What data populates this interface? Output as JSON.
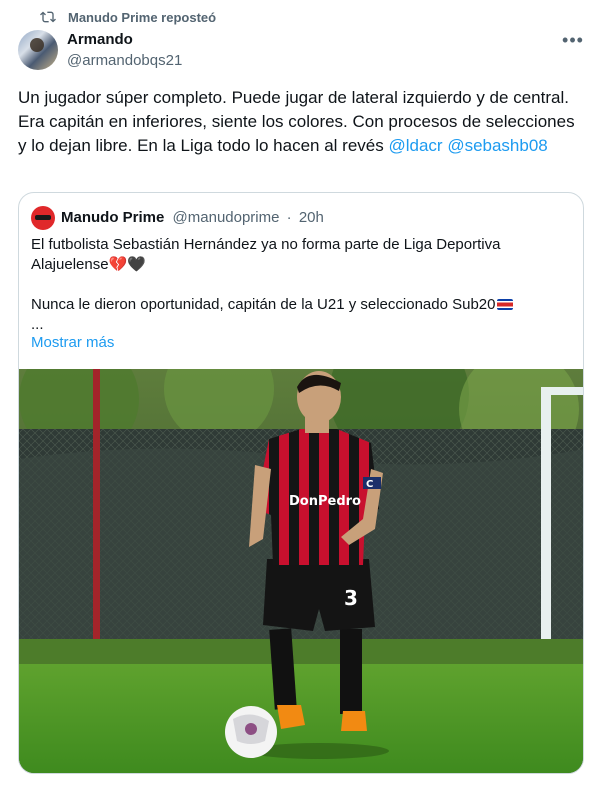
{
  "repost": {
    "label": "Manudo Prime reposteó",
    "icon": "repost-icon"
  },
  "author": {
    "name": "Armando",
    "handle": "@armandobqs21"
  },
  "post": {
    "text": "Un jugador súper completo. Puede jugar de lateral izquierdo y de central. Era capitán en inferiores, siente los colores. Con procesos de selecciones y lo dejan libre. En la Liga todo lo hacen al revés ",
    "mention1": "@ldacr",
    "mention2": "@sebashb08"
  },
  "quote": {
    "name": "Manudo Prime",
    "handle": "@manudoprime",
    "separator": "·",
    "time": "20h",
    "line1": "El futbolista Sebastián Hernández ya no forma parte de Liga Deportiva",
    "line2": "Alajuelense",
    "line3": "Nunca le dieron oportunidad, capitán de la U21 y seleccionado Sub20",
    "ellipsis": "...",
    "show_more": "Mostrar más",
    "emoji": {
      "broken_heart": "💔",
      "black_heart": "🖤",
      "flag": "costa-rica-flag-icon"
    }
  },
  "photo": {
    "jersey_sponsor": "DonPedro",
    "shirt_number": "3",
    "captain_band": "C"
  },
  "colors": {
    "accent": "#1d9bf0",
    "muted": "#536471",
    "border": "#cfd9de",
    "jersey_red": "#c8102e"
  }
}
